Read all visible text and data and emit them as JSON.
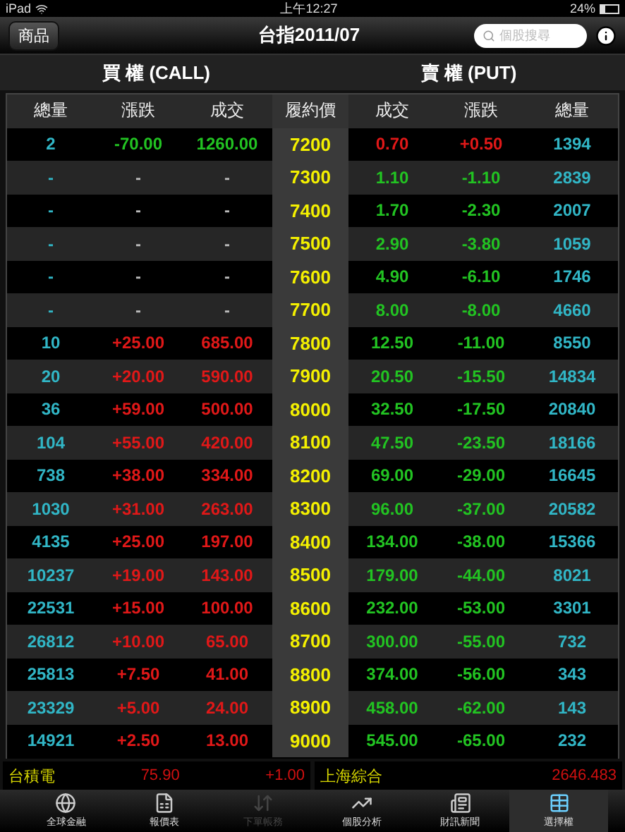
{
  "status_bar": {
    "device": "iPad",
    "time": "上午12:27",
    "battery": "24%"
  },
  "nav": {
    "button": "商品",
    "title": "台指2011/07",
    "search": {
      "placeholder": "個股搜尋"
    }
  },
  "sections": [
    "買 權 (CALL)",
    "賣 權 (PUT)"
  ],
  "columns": [
    "總量",
    "漲跌",
    "成交",
    "履約價",
    "成交",
    "漲跌",
    "總量"
  ],
  "rows": [
    {
      "strike": "7200",
      "call": {
        "volume": "2",
        "change": "-70.00",
        "price": "1260.00",
        "traded": true,
        "rising": false
      },
      "put": {
        "price": "0.70",
        "change": "+0.50",
        "volume": "1394",
        "traded": true,
        "rising": true
      }
    },
    {
      "strike": "7300",
      "call": {
        "volume": "-",
        "change": "-",
        "price": "-",
        "traded": false
      },
      "put": {
        "price": "1.10",
        "change": "-1.10",
        "volume": "2839",
        "traded": true,
        "rising": false
      }
    },
    {
      "strike": "7400",
      "call": {
        "volume": "-",
        "change": "-",
        "price": "-",
        "traded": false
      },
      "put": {
        "price": "1.70",
        "change": "-2.30",
        "volume": "2007",
        "traded": true,
        "rising": false
      }
    },
    {
      "strike": "7500",
      "call": {
        "volume": "-",
        "change": "-",
        "price": "-",
        "traded": false
      },
      "put": {
        "price": "2.90",
        "change": "-3.80",
        "volume": "1059",
        "traded": true,
        "rising": false
      }
    },
    {
      "strike": "7600",
      "call": {
        "volume": "-",
        "change": "-",
        "price": "-",
        "traded": false
      },
      "put": {
        "price": "4.90",
        "change": "-6.10",
        "volume": "1746",
        "traded": true,
        "rising": false
      }
    },
    {
      "strike": "7700",
      "call": {
        "volume": "-",
        "change": "-",
        "price": "-",
        "traded": false
      },
      "put": {
        "price": "8.00",
        "change": "-8.00",
        "volume": "4660",
        "traded": true,
        "rising": false
      }
    },
    {
      "strike": "7800",
      "call": {
        "volume": "10",
        "change": "+25.00",
        "price": "685.00",
        "traded": true,
        "rising": true
      },
      "put": {
        "price": "12.50",
        "change": "-11.00",
        "volume": "8550",
        "traded": true,
        "rising": false
      }
    },
    {
      "strike": "7900",
      "call": {
        "volume": "20",
        "change": "+20.00",
        "price": "590.00",
        "traded": true,
        "rising": true
      },
      "put": {
        "price": "20.50",
        "change": "-15.50",
        "volume": "14834",
        "traded": true,
        "rising": false
      }
    },
    {
      "strike": "8000",
      "call": {
        "volume": "36",
        "change": "+59.00",
        "price": "500.00",
        "traded": true,
        "rising": true
      },
      "put": {
        "price": "32.50",
        "change": "-17.50",
        "volume": "20840",
        "traded": true,
        "rising": false
      }
    },
    {
      "strike": "8100",
      "call": {
        "volume": "104",
        "change": "+55.00",
        "price": "420.00",
        "traded": true,
        "rising": true
      },
      "put": {
        "price": "47.50",
        "change": "-23.50",
        "volume": "18166",
        "traded": true,
        "rising": false
      }
    },
    {
      "strike": "8200",
      "call": {
        "volume": "738",
        "change": "+38.00",
        "price": "334.00",
        "traded": true,
        "rising": true
      },
      "put": {
        "price": "69.00",
        "change": "-29.00",
        "volume": "16645",
        "traded": true,
        "rising": false
      }
    },
    {
      "strike": "8300",
      "call": {
        "volume": "1030",
        "change": "+31.00",
        "price": "263.00",
        "traded": true,
        "rising": true
      },
      "put": {
        "price": "96.00",
        "change": "-37.00",
        "volume": "20582",
        "traded": true,
        "rising": false
      }
    },
    {
      "strike": "8400",
      "call": {
        "volume": "4135",
        "change": "+25.00",
        "price": "197.00",
        "traded": true,
        "rising": true
      },
      "put": {
        "price": "134.00",
        "change": "-38.00",
        "volume": "15366",
        "traded": true,
        "rising": false
      }
    },
    {
      "strike": "8500",
      "call": {
        "volume": "10237",
        "change": "+19.00",
        "price": "143.00",
        "traded": true,
        "rising": true
      },
      "put": {
        "price": "179.00",
        "change": "-44.00",
        "volume": "8021",
        "traded": true,
        "rising": false
      }
    },
    {
      "strike": "8600",
      "call": {
        "volume": "22531",
        "change": "+15.00",
        "price": "100.00",
        "traded": true,
        "rising": true
      },
      "put": {
        "price": "232.00",
        "change": "-53.00",
        "volume": "3301",
        "traded": true,
        "rising": false
      }
    },
    {
      "strike": "8700",
      "call": {
        "volume": "26812",
        "change": "+10.00",
        "price": "65.00",
        "traded": true,
        "rising": true
      },
      "put": {
        "price": "300.00",
        "change": "-55.00",
        "volume": "732",
        "traded": true,
        "rising": false
      }
    },
    {
      "strike": "8800",
      "call": {
        "volume": "25813",
        "change": "+7.50",
        "price": "41.00",
        "traded": true,
        "rising": true
      },
      "put": {
        "price": "374.00",
        "change": "-56.00",
        "volume": "343",
        "traded": true,
        "rising": false
      }
    },
    {
      "strike": "8900",
      "call": {
        "volume": "23329",
        "change": "+5.00",
        "price": "24.00",
        "traded": true,
        "rising": true
      },
      "put": {
        "price": "458.00",
        "change": "-62.00",
        "volume": "143",
        "traded": true,
        "rising": false
      }
    },
    {
      "strike": "9000",
      "call": {
        "volume": "14921",
        "change": "+2.50",
        "price": "13.00",
        "traded": true,
        "rising": true
      },
      "put": {
        "price": "545.00",
        "change": "-65.00",
        "volume": "232",
        "traded": true,
        "rising": false
      }
    }
  ],
  "ticker": [
    {
      "name": "台積電",
      "price": "75.90",
      "change": "+1.00"
    },
    {
      "name": "上海綜合",
      "price": "2646.483"
    }
  ],
  "tab_bar": [
    {
      "label": "全球金融",
      "selected": false,
      "disabled": false
    },
    {
      "label": "報價表",
      "selected": false,
      "disabled": false
    },
    {
      "label": "下單帳務",
      "selected": false,
      "disabled": true
    },
    {
      "label": "個股分析",
      "selected": false,
      "disabled": false
    },
    {
      "label": "財訊新聞",
      "selected": false,
      "disabled": false
    },
    {
      "label": "選擇權",
      "selected": true,
      "disabled": false
    }
  ]
}
